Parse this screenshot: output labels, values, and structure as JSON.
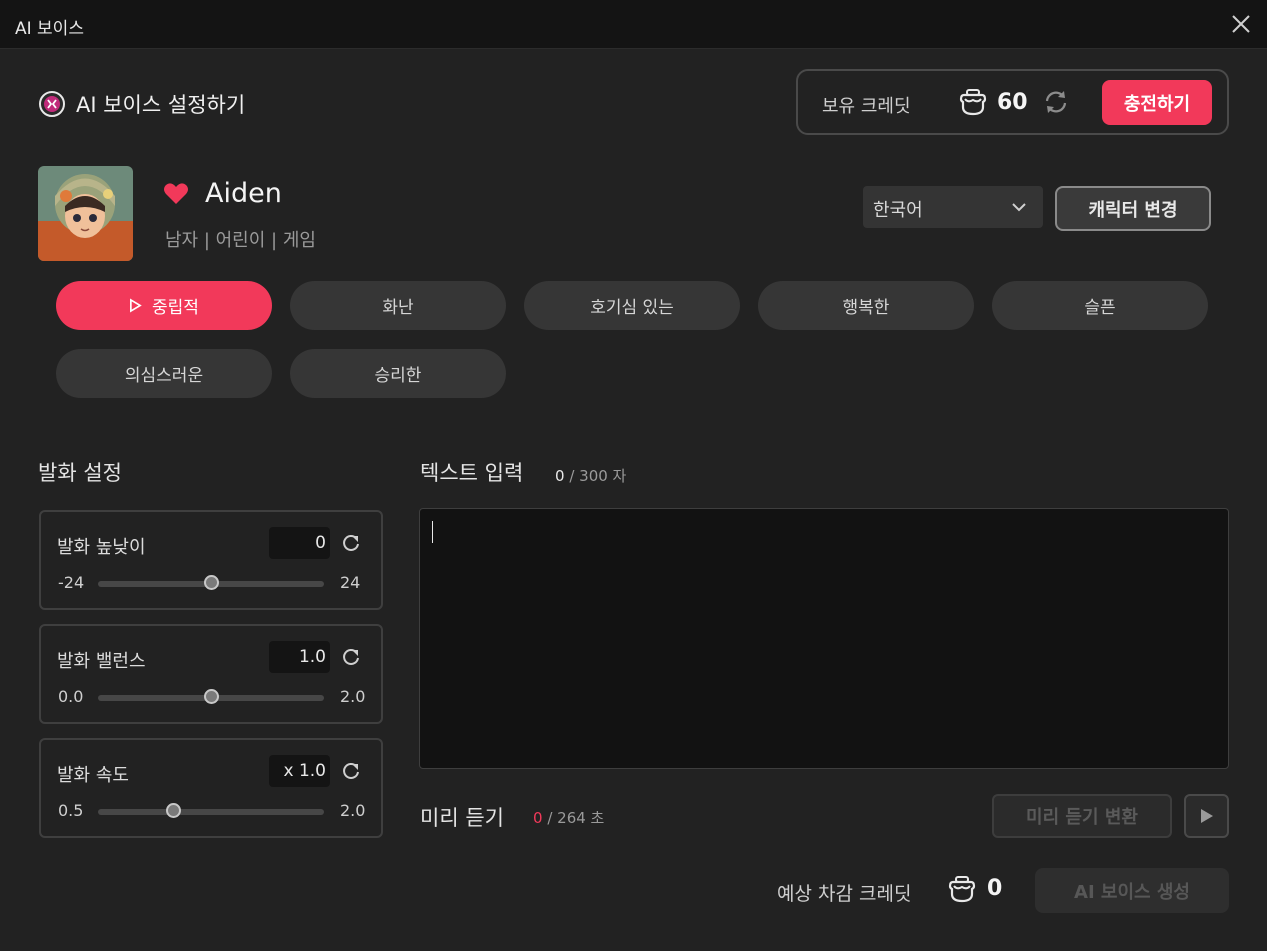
{
  "window": {
    "title": "AI 보이스",
    "close_icon": "close-icon"
  },
  "header": {
    "title": "AI 보이스 설정하기",
    "logo_icon": "ai-voice-logo-icon",
    "credit_label": "보유 크레딧",
    "credit_icon": "credit-pot-icon",
    "credit_count": "60",
    "refresh_icon": "refresh-icon",
    "charge_label": "충전하기"
  },
  "character": {
    "name": "Aiden",
    "tags": "남자 | 어린이 | 게임",
    "favorite_icon": "heart-icon",
    "avatar_icon": "character-avatar-image"
  },
  "language": {
    "selected": "한국어"
  },
  "change_character_label": "캐릭터 변경",
  "emotions": [
    {
      "label": "중립적",
      "active": true
    },
    {
      "label": "화난",
      "active": false
    },
    {
      "label": "호기심 있는",
      "active": false
    },
    {
      "label": "행복한",
      "active": false
    },
    {
      "label": "슬픈",
      "active": false
    },
    {
      "label": "의심스러운",
      "active": false
    },
    {
      "label": "승리한",
      "active": false
    }
  ],
  "speech_settings": {
    "title": "발화 설정",
    "params": [
      {
        "name": "발화 높낮이",
        "value": "0",
        "min": "-24",
        "max": "24",
        "level": 0.5
      },
      {
        "name": "발화 밸런스",
        "value": "1.0",
        "min": "0.0",
        "max": "2.0",
        "level": 0.5
      },
      {
        "name": "발화 속도",
        "value": "x 1.0",
        "min": "0.5",
        "max": "2.0",
        "level": 0.333
      }
    ]
  },
  "text_input": {
    "title": "텍스트 입력",
    "count": "0",
    "limit": "/ 300 자",
    "value": ""
  },
  "preview": {
    "title": "미리 듣기",
    "count": "0",
    "limit": "/ 264 초",
    "convert_label": "미리 듣기 변환",
    "play_icon": "play-icon"
  },
  "estimate": {
    "label": "예상 차감 크레딧",
    "count": "0"
  },
  "generate_label": "AI 보이스 생성",
  "colors": {
    "accent": "#f2395a",
    "background": "#222222",
    "titlebar": "#141414"
  }
}
